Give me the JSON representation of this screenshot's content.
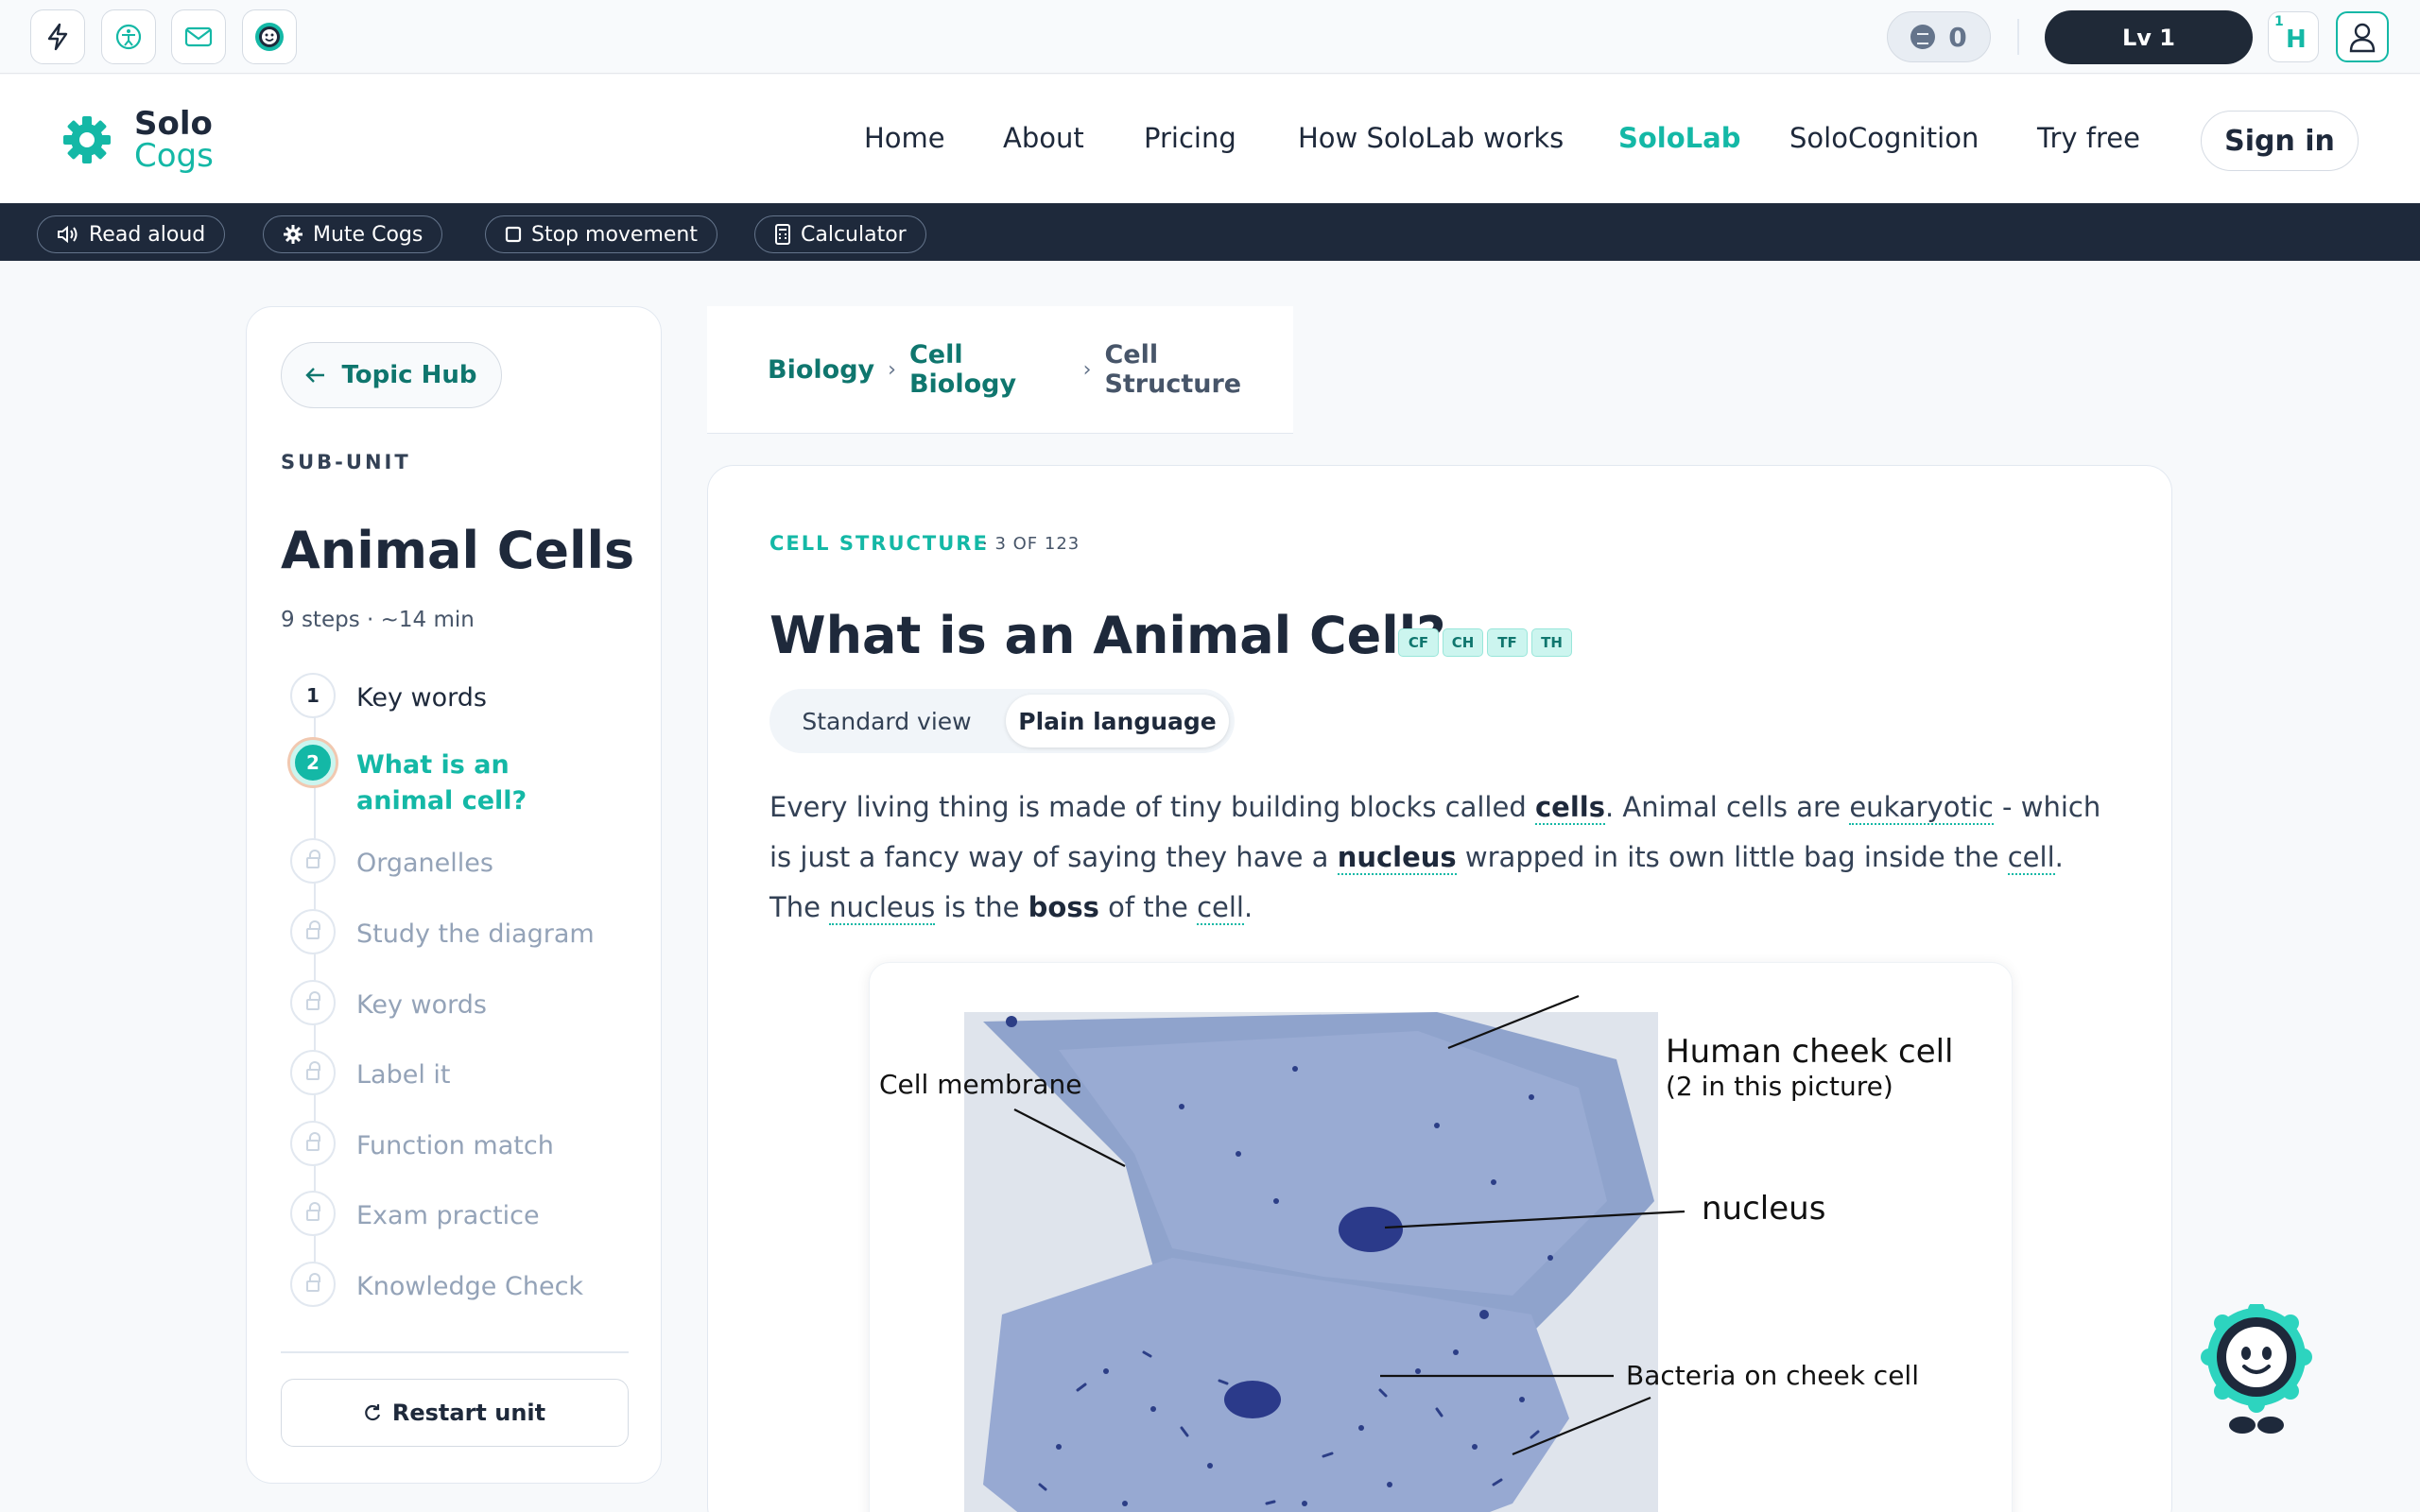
{
  "utility": {
    "coins": "0",
    "level": "Lv 1",
    "hint_sup": "1",
    "hint_letter": "H",
    "icons": [
      "bolt-icon",
      "accessibility-icon",
      "mail-icon",
      "cog-robot-icon",
      "coin-icon",
      "user-icon"
    ]
  },
  "header": {
    "logo_top": "Solo",
    "logo_bottom": "Cogs",
    "nav": [
      "Home",
      "About",
      "Pricing",
      "How SoloLab works",
      "SoloLab",
      "SoloCognition",
      "Try free"
    ],
    "active_nav": "SoloLab",
    "sign_in": "Sign in"
  },
  "a11y": {
    "read_aloud": "Read aloud",
    "mute": "Mute Cogs",
    "stop": "Stop movement",
    "calculator": "Calculator"
  },
  "sidebar": {
    "topic_hub": "Topic Hub",
    "subunit_label": "SUB-UNIT",
    "unit_title": "Animal Cells",
    "unit_meta": "9 steps · ~14 min",
    "steps": [
      {
        "num": "1",
        "label": "Key words",
        "state": "done"
      },
      {
        "num": "2",
        "label": "What is an animal cell?",
        "state": "active"
      },
      {
        "num": "",
        "label": "Organelles",
        "state": "locked"
      },
      {
        "num": "",
        "label": "Study the diagram",
        "state": "locked"
      },
      {
        "num": "",
        "label": "Key words",
        "state": "locked"
      },
      {
        "num": "",
        "label": "Label it",
        "state": "locked"
      },
      {
        "num": "",
        "label": "Function match",
        "state": "locked"
      },
      {
        "num": "",
        "label": "Exam practice",
        "state": "locked"
      },
      {
        "num": "",
        "label": "Knowledge Check",
        "state": "locked"
      }
    ],
    "restart": "Restart unit"
  },
  "breadcrumb": {
    "items": [
      "Biology",
      "Cell Biology",
      "Cell Structure"
    ],
    "separator": "›"
  },
  "lesson": {
    "kicker": "CELL STRUCTURE",
    "count": "· 3 OF 123",
    "title": "What is an Animal Cell?",
    "tags": [
      "CF",
      "CH",
      "TF",
      "TH"
    ],
    "view_standard": "Standard view",
    "view_plain": "Plain language",
    "paragraph": {
      "p1": "Every living thing is made of tiny building blocks called ",
      "t1": "cells",
      "p2": ". Animal cells are ",
      "t2": "eukaryotic",
      "p3": " - which is just a fancy way of saying they have a ",
      "t3": "nucleus",
      "p4": " wrapped in its own little bag inside the ",
      "t4": "cell",
      "p5": ". The ",
      "t5": "nucleus",
      "p6": " is the ",
      "t6": "boss",
      "p7": " of the ",
      "t7": "cell",
      "p8": "."
    },
    "figure": {
      "label_membrane": "Cell membrane",
      "label_cheek_1": "Human cheek cell",
      "label_cheek_2": "(2 in this picture)",
      "label_nucleus": "nucleus",
      "label_bacteria": "Bacteria on cheek cell"
    }
  },
  "colors": {
    "accent": "#14b8a6",
    "dark": "#1e293b",
    "a11y_bar": "#1e293b"
  }
}
